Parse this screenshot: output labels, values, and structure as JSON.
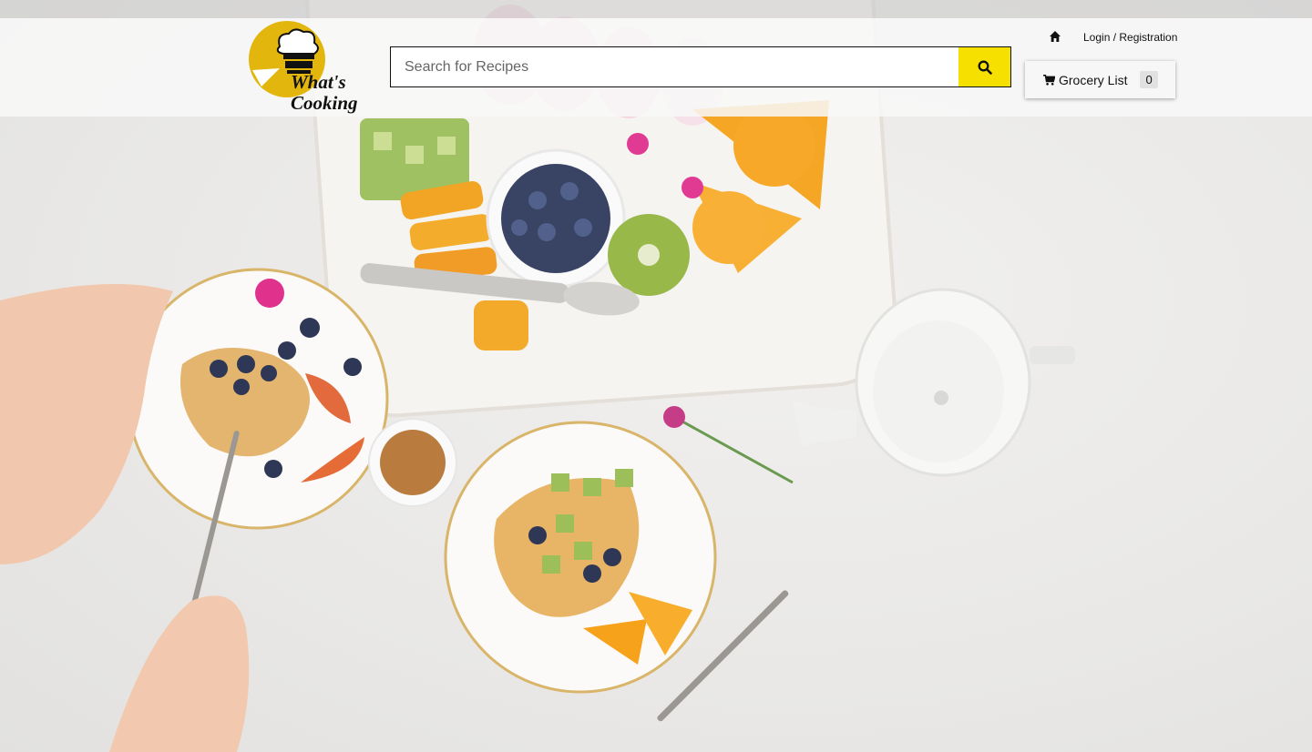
{
  "brand": {
    "logo_line1": "What's",
    "logo_line2": "Cooking",
    "logo_color": "#e2b60d"
  },
  "search": {
    "placeholder": "Search for Recipes",
    "value": "",
    "button_icon": "search-icon",
    "button_color": "#f5e000"
  },
  "nav": {
    "home_icon": "home-icon",
    "login_label": "Login / Registration"
  },
  "grocery": {
    "icon": "shopping-cart-icon",
    "label": "Grocery List",
    "count": "0"
  },
  "hero": {
    "image": "breakfast-table-photo"
  }
}
